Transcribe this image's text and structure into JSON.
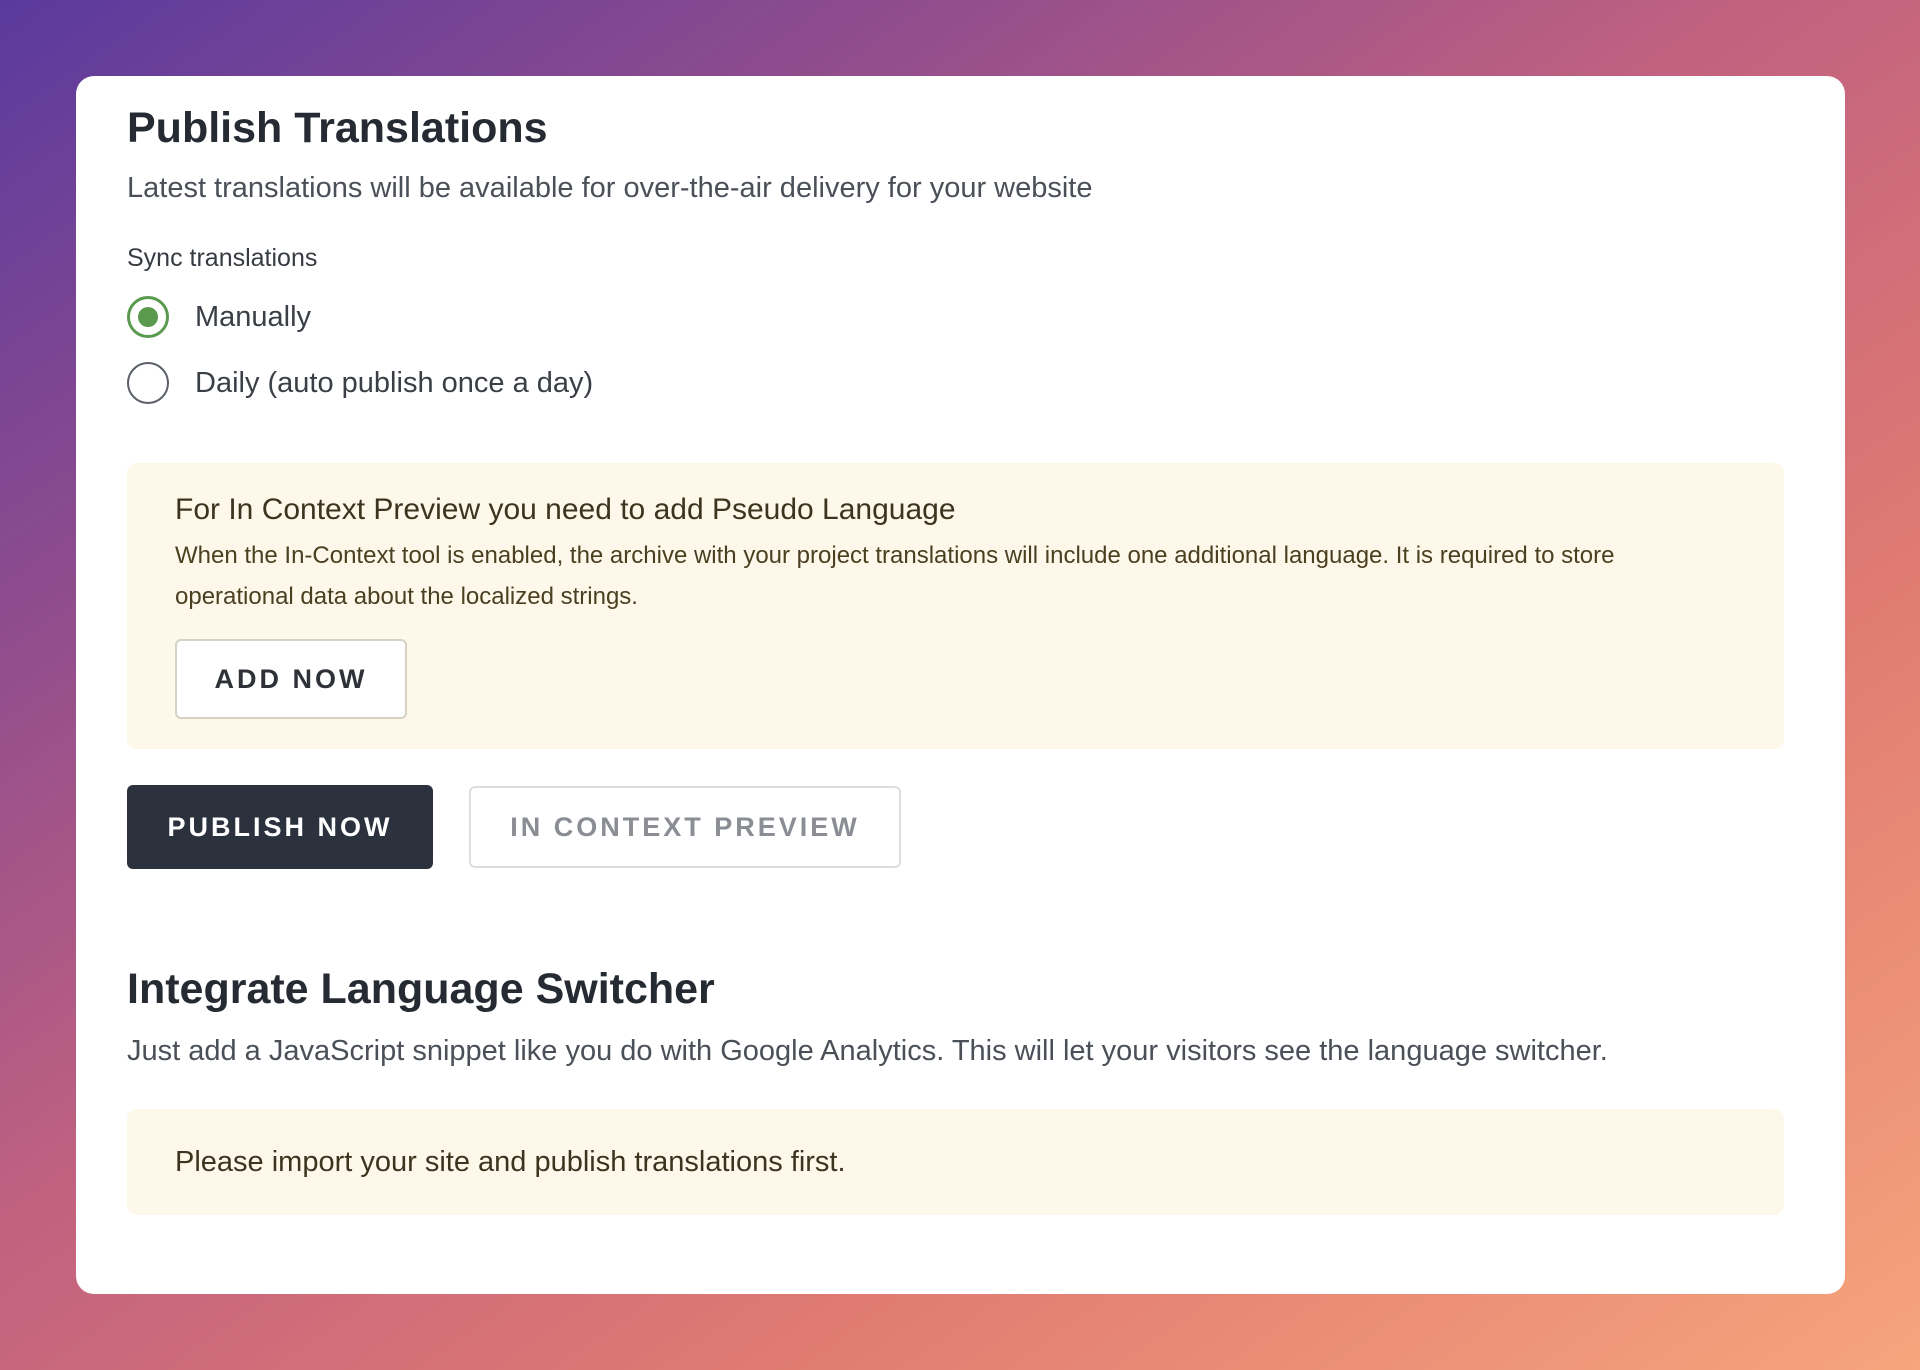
{
  "publish": {
    "title": "Publish Translations",
    "subtitle": "Latest translations will be available for over-the-air delivery for your website",
    "sync_label": "Sync translations",
    "options": [
      {
        "label": "Manually",
        "checked": true
      },
      {
        "label": "Daily (auto publish once a day)",
        "checked": false
      }
    ],
    "notice": {
      "title": "For In Context Preview you need to add Pseudo Language",
      "body": "When the In-Context tool is enabled, the archive with your project translations will include one additional language. It is required to store operational data about the localized strings.",
      "button_label": "ADD NOW"
    },
    "publish_button": "PUBLISH NOW",
    "preview_button": "IN CONTEXT PREVIEW"
  },
  "switcher": {
    "title": "Integrate Language Switcher",
    "subtitle": "Just add a JavaScript snippet like you do with Google Analytics. This will let your visitors see the language switcher.",
    "notice_text": "Please import your site and publish translations first."
  },
  "colors": {
    "radio_checked": "#5a9a4f",
    "primary_button": "#2b313d",
    "notice_bg": "#fdf8ea"
  }
}
